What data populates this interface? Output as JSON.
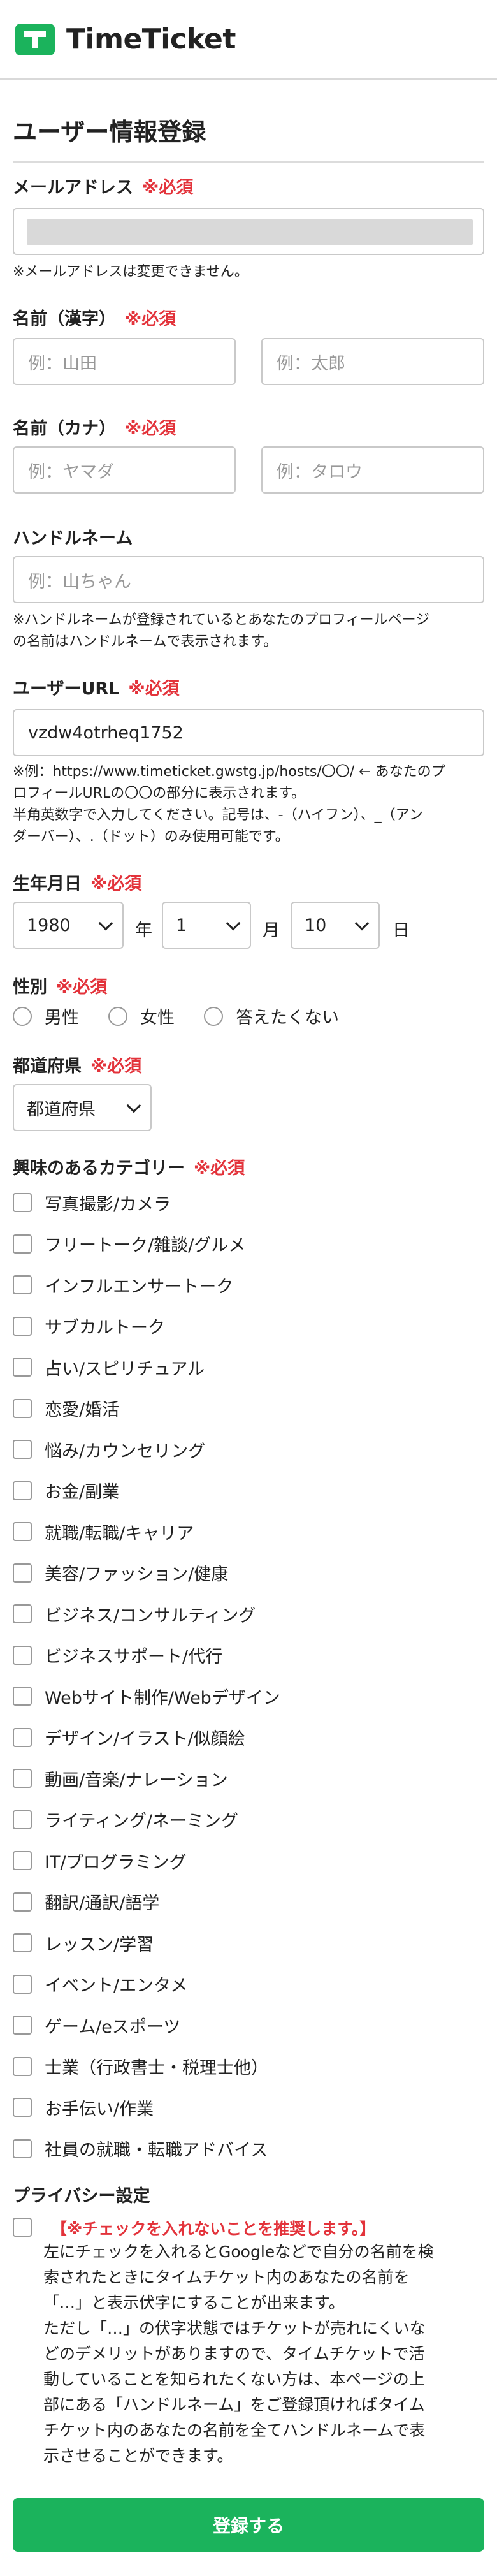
{
  "header": {
    "logo_text": "TimeTicket",
    "brand_color": "#1bb35c"
  },
  "page": {
    "title": "ユーザー情報登録"
  },
  "required_mark": "※必須",
  "email": {
    "label": "メールアドレス",
    "note": "※メールアドレスは変更できません。"
  },
  "name_kanji": {
    "label": "名前（漢字）",
    "last_placeholder": "例：山田",
    "first_placeholder": "例：太郎"
  },
  "name_kana": {
    "label": "名前（カナ）",
    "last_placeholder": "例：ヤマダ",
    "first_placeholder": "例：タロウ"
  },
  "handle": {
    "label": "ハンドルネーム",
    "placeholder": "例：山ちゃん",
    "note_line1": "※ハンドルネームが登録されているとあなたのプロフィールページ",
    "note_line2": "の名前はハンドルネームで表示されます。"
  },
  "user_url": {
    "label": "ユーザーURL",
    "value": "vzdw4otrheq1752",
    "note_line1": "※例：https://www.timeticket.gwstg.jp/hosts/〇〇/ ← あなたのプ",
    "note_line2": "ロフィールURLの〇〇の部分に表示されます。",
    "note_line3": "半角英数字で入力してください。記号は、-（ハイフン）、_（アン",
    "note_line4": "ダーバー）、.（ドット）のみ使用可能です。"
  },
  "birthday": {
    "label": "生年月日",
    "year": "1980",
    "year_unit": "年",
    "month": "1",
    "month_unit": "月",
    "day": "10",
    "day_unit": "日"
  },
  "gender": {
    "label": "性別",
    "options": [
      "男性",
      "女性",
      "答えたくない"
    ]
  },
  "prefecture": {
    "label": "都道府県",
    "selected": "都道府県"
  },
  "categories": {
    "label": "興味のあるカテゴリー",
    "items": [
      "写真撮影/カメラ",
      "フリートーク/雑談/グルメ",
      "インフルエンサートーク",
      "サブカルトーク",
      "占い/スピリチュアル",
      "恋愛/婚活",
      "悩み/カウンセリング",
      "お金/副業",
      "就職/転職/キャリア",
      "美容/ファッション/健康",
      "ビジネス/コンサルティング",
      "ビジネスサポート/代行",
      "Webサイト制作/Webデザイン",
      "デザイン/イラスト/似顔絵",
      "動画/音楽/ナレーション",
      "ライティング/ネーミング",
      "IT/プログラミング",
      "翻訳/通訳/語学",
      "レッスン/学習",
      "イベント/エンタメ",
      "ゲーム/eスポーツ",
      "士業（行政書士・税理士他）",
      "お手伝い/作業",
      "社員の就職・転職アドバイス"
    ]
  },
  "privacy": {
    "label": "プライバシー設定",
    "recommend": "【※チェックを入れないことを推奨します。】",
    "lines": [
      "左にチェックを入れるとGoogleなどで自分の名前を検",
      "索されたときにタイムチケット内のあなたの名前を",
      "「…」と表示伏字にすることが出来ます。",
      "ただし「…」の伏字状態ではチケットが売れにくいな",
      "どのデメリットがありますので、タイムチケットで活",
      "動していることを知られたくない方は、本ページの上",
      "部にある「ハンドルネーム」をご登録頂ければタイム",
      "チケット内のあなたの名前を全てハンドルネームで表",
      "示させることができます。"
    ]
  },
  "submit_label": "登録する"
}
